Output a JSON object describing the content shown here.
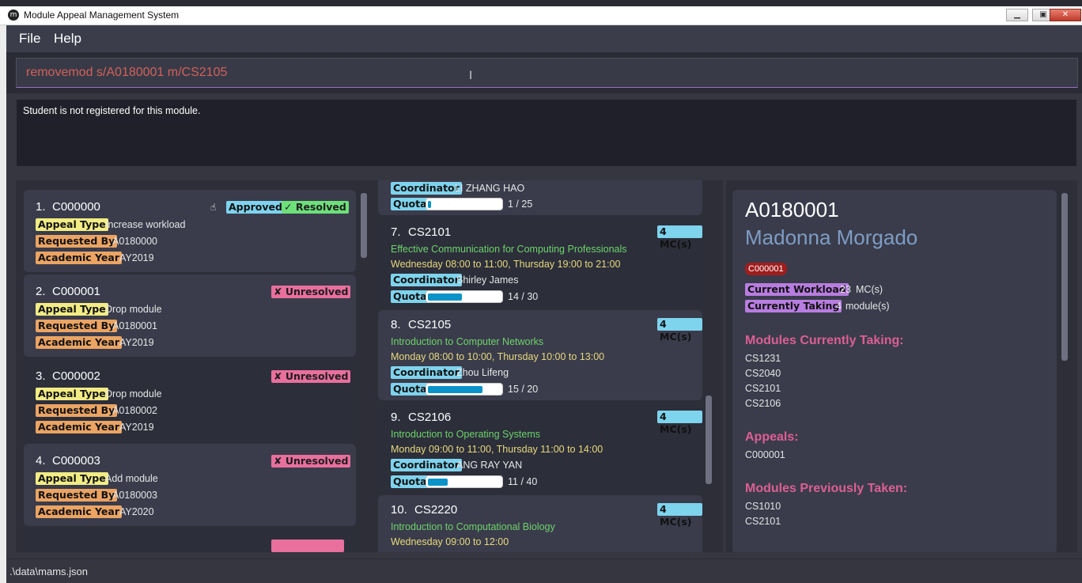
{
  "window": {
    "title": "Module Appeal Management System",
    "icon": "m-logo-icon"
  },
  "menu": {
    "file": "File",
    "help": "Help"
  },
  "command": {
    "value": "removemod s/A0180001 m/CS2105"
  },
  "result": {
    "text": "Student is not registered for this module."
  },
  "labels": {
    "appeal_type": "Appeal Type",
    "requested_by": "Requested By",
    "academic_year": "Academic Year",
    "coordinator": "Coordinator",
    "quota": "Quota",
    "current_workload": "Current Workload",
    "currently_taking": "Currently Taking"
  },
  "appeals": [
    {
      "index": "1.",
      "id": "C000000",
      "type": "Increase workload",
      "requested_by": "A0180000",
      "year": "AY2019",
      "approved": "Approved",
      "status": "✓ Resolved"
    },
    {
      "index": "2.",
      "id": "C000001",
      "type": "Drop module",
      "requested_by": "A0180001",
      "year": "AY2019",
      "status": "✘ Unresolved"
    },
    {
      "index": "3.",
      "id": "C000002",
      "type": "Drop module",
      "requested_by": "A0180002",
      "year": "AY2019",
      "status": "✘ Unresolved"
    },
    {
      "index": "4.",
      "id": "C000003",
      "type": "Add module",
      "requested_by": "A0180003",
      "year": "AY2020",
      "status": "✘ Unresolved"
    }
  ],
  "modules": [
    {
      "coordinator_partial": "LI ZHANG HAO",
      "quota_text": "1 / 25",
      "quota_fraction": 0.04
    },
    {
      "index": "7.",
      "code": "CS2101",
      "mc": "4 MC(s)",
      "name": "Effective Communication for Computing Professionals",
      "time": "Wednesday 08:00 to 11:00, Thursday 19:00 to 21:00",
      "coordinator": "Shirley James",
      "quota_text": "14 / 30",
      "quota_fraction": 0.467
    },
    {
      "index": "8.",
      "code": "CS2105",
      "mc": "4 MC(s)",
      "name": "Introduction to Computer Networks",
      "time": "Monday 08:00 to 10:00, Thursday 10:00 to 13:00",
      "coordinator": "Zhou Lifeng",
      "quota_text": "15 / 20",
      "quota_fraction": 0.75
    },
    {
      "index": "9.",
      "code": "CS2106",
      "mc": "4 MC(s)",
      "name": "Introduction to Operating Systems",
      "time": "Monday 09:00 to 11:00, Thursday 11:00 to 14:00",
      "coordinator": "ANG RAY YAN",
      "quota_text": "11 / 40",
      "quota_fraction": 0.275
    },
    {
      "index": "10.",
      "code": "CS2220",
      "mc": "4 MC(s)",
      "name": "Introduction to Computational Biology",
      "time": "Wednesday 09:00 to 12:00"
    }
  ],
  "student": {
    "id": "A0180001",
    "name": "Madonna Morgado",
    "tag": "C000001",
    "workload_value": "23",
    "workload_unit": "MC(s)",
    "taking_value": "4",
    "taking_unit": "module(s)",
    "current_heading": "Modules Currently Taking:",
    "current_modules": [
      "CS1231",
      "CS2040",
      "CS2101",
      "CS2106"
    ],
    "appeals_heading": "Appeals:",
    "appeals": [
      "C000001"
    ],
    "previous_heading": "Modules Previously Taken:",
    "previous_modules": [
      "CS1010",
      "CS2101"
    ]
  },
  "status": {
    "path": ".\\data\\mams.json"
  },
  "colors": {
    "accent_purple": "#9b6fc7",
    "command_text": "#d1615a",
    "heading_pink": "#dd5f94",
    "name_blue": "#7f9dc4"
  }
}
